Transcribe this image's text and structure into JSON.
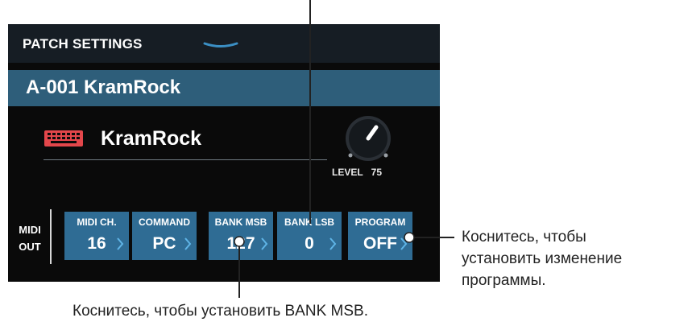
{
  "header": {
    "title": "PATCH SETTINGS"
  },
  "patch": {
    "name": "A-001 KramRock"
  },
  "instrument": {
    "name": "KramRock",
    "icon": "keyboard-icon",
    "icon_color": "#e3474b"
  },
  "level": {
    "label": "LEVEL",
    "value": "75"
  },
  "midi_out": {
    "line1": "MIDI",
    "line2": "OUT"
  },
  "params": [
    {
      "label": "MIDI CH.",
      "value": "16"
    },
    {
      "label": "COMMAND",
      "value": "PC"
    },
    {
      "label": "BANK MSB",
      "value": "127"
    },
    {
      "label": "BANK LSB",
      "value": "0"
    },
    {
      "label": "PROGRAM",
      "value": "OFF"
    }
  ],
  "callouts": {
    "program": [
      "Коснитесь, чтобы",
      "установить изменение",
      "программы."
    ],
    "bank_msb": "Коснитесь, чтобы установить BANK MSB."
  },
  "colors": {
    "accent": "#2f6c94",
    "name_bar": "#2e5e7a",
    "header": "#161d24",
    "screen": "#0a0a0a"
  }
}
